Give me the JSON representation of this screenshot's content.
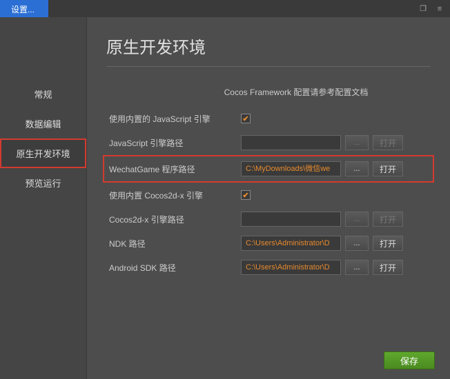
{
  "titlebar": {
    "tab": "设置..."
  },
  "sidebar": {
    "items": [
      {
        "label": "常规"
      },
      {
        "label": "数据编辑"
      },
      {
        "label": "原生开发环境"
      },
      {
        "label": "预览运行"
      }
    ]
  },
  "content": {
    "title": "原生开发环境",
    "hint": "Cocos Framework 配置请参考配置文档",
    "rows": {
      "js_builtin": {
        "label": "使用内置的 JavaScript 引擎",
        "checked": true
      },
      "js_path": {
        "label": "JavaScript 引擎路径",
        "value": "",
        "browse": "...",
        "open": "打开"
      },
      "wechat": {
        "label": "WechatGame 程序路径",
        "value": "C:\\MyDownloads\\微信we",
        "browse": "...",
        "open": "打开"
      },
      "cocos_builtin": {
        "label": "使用内置 Cocos2d-x 引擎",
        "checked": true
      },
      "cocos_path": {
        "label": "Cocos2d-x 引擎路径",
        "value": "",
        "browse": "...",
        "open": "打开"
      },
      "ndk": {
        "label": "NDK 路径",
        "value": "C:\\Users\\Administrator\\D",
        "browse": "...",
        "open": "打开"
      },
      "sdk": {
        "label": "Android SDK 路径",
        "value": "C:\\Users\\Administrator\\D",
        "browse": "...",
        "open": "打开"
      }
    },
    "save": "保存"
  }
}
